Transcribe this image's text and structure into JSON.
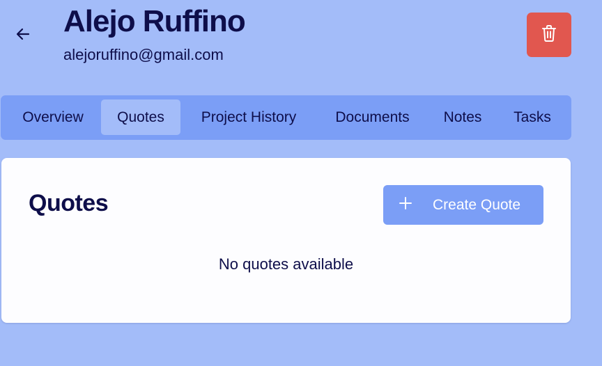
{
  "header": {
    "back_icon": "arrow-left-icon",
    "name": "Alejo Ruffino",
    "email": "alejoruffino@gmail.com",
    "delete_icon": "trash-icon"
  },
  "tabs": [
    {
      "label": "Overview",
      "active": false
    },
    {
      "label": "Quotes",
      "active": true
    },
    {
      "label": "Project History",
      "active": false
    },
    {
      "label": "Documents",
      "active": false
    },
    {
      "label": "Notes",
      "active": false
    },
    {
      "label": "Tasks",
      "active": false
    }
  ],
  "quotes_section": {
    "title": "Quotes",
    "create_button_label": "Create Quote",
    "create_button_icon": "plus-icon",
    "empty_message": "No quotes available"
  },
  "colors": {
    "page_background": "#a3bcf9",
    "tabs_background": "#7b9ef6",
    "active_tab": "#a3bcf9",
    "delete_button": "#e1574f",
    "primary_button": "#7b9ef6",
    "text": "#0e0e4a",
    "card": "#fdfdff"
  }
}
